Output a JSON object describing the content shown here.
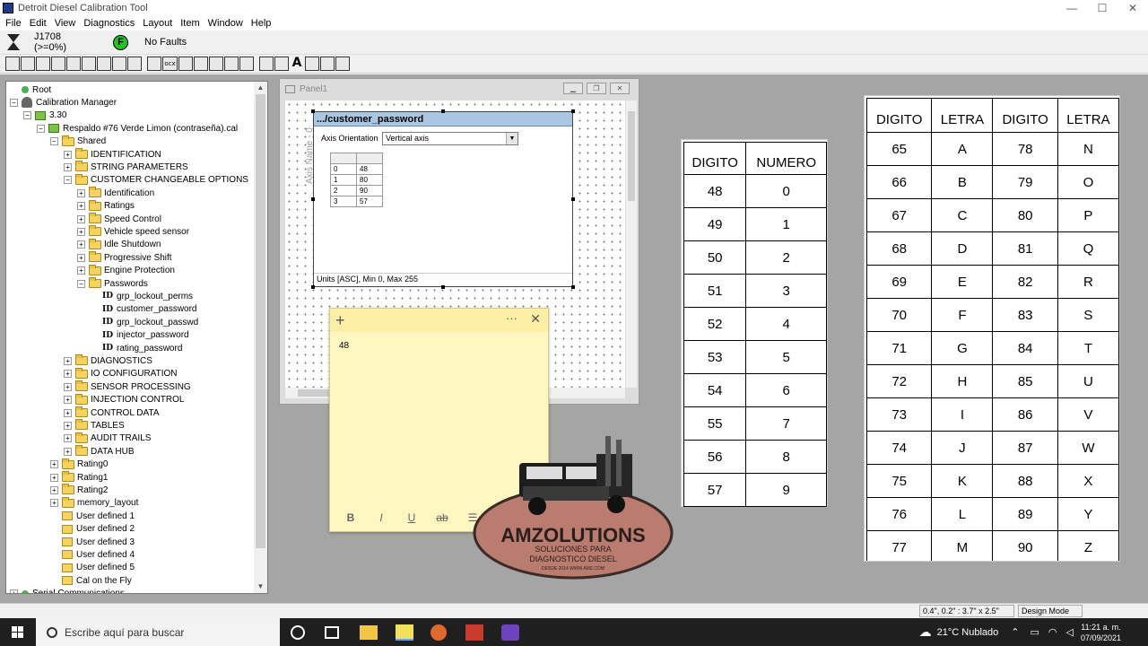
{
  "window": {
    "title": "Detroit Diesel Calibration Tool",
    "min": "—",
    "max": "☐",
    "close": "✕"
  },
  "menu": [
    "File",
    "Edit",
    "View",
    "Diagnostics",
    "Layout",
    "Item",
    "Window",
    "Help"
  ],
  "status": {
    "j1708": "J1708 (>=0%)",
    "fault_letter": "F",
    "faults": "No Faults"
  },
  "toolbar_icons": [
    "chart",
    "grid",
    "tools",
    "rect",
    "table",
    "truck",
    "curve",
    "thermo",
    "bar",
    "sep",
    "panel",
    "ocx",
    "matrix",
    "plusminus1",
    "plusminus2",
    "plusminus3",
    "plusminus4",
    "sep",
    "box",
    "dots",
    "text",
    "picture",
    "slider",
    "label"
  ],
  "tree": [
    {
      "label": "Root",
      "indent": 0,
      "icon": "dot",
      "exp": ""
    },
    {
      "label": "Calibration Manager",
      "indent": 0,
      "icon": "person",
      "exp": "−"
    },
    {
      "label": "3.30",
      "indent": 1,
      "icon": "cal",
      "exp": "−"
    },
    {
      "label": "Respaldo #76 Verde Limon (contraseña).cal",
      "indent": 2,
      "icon": "cal",
      "exp": "−"
    },
    {
      "label": "Shared",
      "indent": 3,
      "icon": "folder",
      "exp": "−"
    },
    {
      "label": "IDENTIFICATION",
      "indent": 4,
      "icon": "folder",
      "exp": "+"
    },
    {
      "label": "STRING PARAMETERS",
      "indent": 4,
      "icon": "folder",
      "exp": "+"
    },
    {
      "label": "CUSTOMER CHANGEABLE OPTIONS",
      "indent": 4,
      "icon": "folder",
      "exp": "−"
    },
    {
      "label": "Identification",
      "indent": 5,
      "icon": "folder",
      "exp": "+"
    },
    {
      "label": "Ratings",
      "indent": 5,
      "icon": "folder",
      "exp": "+"
    },
    {
      "label": "Speed Control",
      "indent": 5,
      "icon": "folder",
      "exp": "+"
    },
    {
      "label": "Vehicle speed sensor",
      "indent": 5,
      "icon": "folder",
      "exp": "+"
    },
    {
      "label": "Idle Shutdown",
      "indent": 5,
      "icon": "folder",
      "exp": "+"
    },
    {
      "label": "Progressive Shift",
      "indent": 5,
      "icon": "folder",
      "exp": "+"
    },
    {
      "label": "Engine Protection",
      "indent": 5,
      "icon": "folder",
      "exp": "+"
    },
    {
      "label": "Passwords",
      "indent": 5,
      "icon": "folder",
      "exp": "−"
    },
    {
      "label": "grp_lockout_perms",
      "indent": 6,
      "icon": "id",
      "exp": ""
    },
    {
      "label": "customer_password",
      "indent": 6,
      "icon": "id",
      "exp": ""
    },
    {
      "label": "grp_lockout_passwd",
      "indent": 6,
      "icon": "id",
      "exp": ""
    },
    {
      "label": "injector_password",
      "indent": 6,
      "icon": "id",
      "exp": ""
    },
    {
      "label": "rating_password",
      "indent": 6,
      "icon": "id",
      "exp": ""
    },
    {
      "label": "DIAGNOSTICS",
      "indent": 4,
      "icon": "folder",
      "exp": "+"
    },
    {
      "label": "IO CONFIGURATION",
      "indent": 4,
      "icon": "folder",
      "exp": "+"
    },
    {
      "label": "SENSOR PROCESSING",
      "indent": 4,
      "icon": "folder",
      "exp": "+"
    },
    {
      "label": "INJECTION CONTROL",
      "indent": 4,
      "icon": "folder",
      "exp": "+"
    },
    {
      "label": "CONTROL DATA",
      "indent": 4,
      "icon": "folder",
      "exp": "+"
    },
    {
      "label": "TABLES",
      "indent": 4,
      "icon": "folder",
      "exp": "+"
    },
    {
      "label": "AUDIT TRAILS",
      "indent": 4,
      "icon": "folder",
      "exp": "+"
    },
    {
      "label": "DATA HUB",
      "indent": 4,
      "icon": "folder",
      "exp": "+"
    },
    {
      "label": "Rating0",
      "indent": 3,
      "icon": "folder",
      "exp": "+"
    },
    {
      "label": "Rating1",
      "indent": 3,
      "icon": "folder",
      "exp": "+"
    },
    {
      "label": "Rating2",
      "indent": 3,
      "icon": "folder",
      "exp": "+"
    },
    {
      "label": "memory_layout",
      "indent": 3,
      "icon": "folder",
      "exp": "+"
    },
    {
      "label": "User defined 1",
      "indent": 3,
      "icon": "user",
      "exp": ""
    },
    {
      "label": "User defined 2",
      "indent": 3,
      "icon": "user",
      "exp": ""
    },
    {
      "label": "User defined 3",
      "indent": 3,
      "icon": "user",
      "exp": ""
    },
    {
      "label": "User defined 4",
      "indent": 3,
      "icon": "user",
      "exp": ""
    },
    {
      "label": "User defined 5",
      "indent": 3,
      "icon": "user",
      "exp": ""
    },
    {
      "label": "Cal on the Fly",
      "indent": 3,
      "icon": "user",
      "exp": ""
    },
    {
      "label": "Serial Communications",
      "indent": 0,
      "icon": "dot",
      "exp": "+"
    }
  ],
  "panel1": {
    "title": "Panel1"
  },
  "widget": {
    "title": ".../customer_password",
    "orientation_label": "Axis Orientation",
    "orientation_value": "Vertical axis",
    "axis_name": "Axis Name - 0",
    "rows": [
      [
        "0",
        "48"
      ],
      [
        "1",
        "80"
      ],
      [
        "2",
        "90"
      ],
      [
        "3",
        "57"
      ]
    ],
    "units": "Units [ASC], Min 0, Max 255"
  },
  "sticky": {
    "plus": "+",
    "more": "···",
    "close": "✕",
    "text": "48",
    "bold": "B",
    "italic": "I",
    "underline": "U",
    "strike": "ab",
    "list": "☰"
  },
  "logo": {
    "name": "AMZOLUTIONS",
    "line1": "SOLUCIONES PARA",
    "line2": "DIAGNOSTICO DIESEL",
    "line3": "DESDE 2014 WWW.AMZ.COM"
  },
  "num_table": {
    "headers": [
      "DIGITO",
      "NUMERO"
    ],
    "rows": [
      [
        "48",
        "0"
      ],
      [
        "49",
        "1"
      ],
      [
        "50",
        "2"
      ],
      [
        "51",
        "3"
      ],
      [
        "52",
        "4"
      ],
      [
        "53",
        "5"
      ],
      [
        "54",
        "6"
      ],
      [
        "55",
        "7"
      ],
      [
        "56",
        "8"
      ],
      [
        "57",
        "9"
      ]
    ]
  },
  "let_table": {
    "headers": [
      "DIGITO",
      "LETRA",
      "DIGITO",
      "LETRA"
    ],
    "rows": [
      [
        "65",
        "A",
        "78",
        "N"
      ],
      [
        "66",
        "B",
        "79",
        "O"
      ],
      [
        "67",
        "C",
        "80",
        "P"
      ],
      [
        "68",
        "D",
        "81",
        "Q"
      ],
      [
        "69",
        "E",
        "82",
        "R"
      ],
      [
        "70",
        "F",
        "83",
        "S"
      ],
      [
        "71",
        "G",
        "84",
        "T"
      ],
      [
        "72",
        "H",
        "85",
        "U"
      ],
      [
        "73",
        "I",
        "86",
        "V"
      ],
      [
        "74",
        "J",
        "87",
        "W"
      ],
      [
        "75",
        "K",
        "88",
        "X"
      ],
      [
        "76",
        "L",
        "89",
        "Y"
      ],
      [
        "77",
        "M",
        "90",
        "Z"
      ]
    ]
  },
  "design_bar": {
    "coords": "0.4\", 0.2\" : 3.7\" x 2.5\"",
    "mode": "Design Mode"
  },
  "taskbar": {
    "search_placeholder": "Escribe aquí para buscar",
    "weather": "21°C  Nublado",
    "time": "11:21 a. m.",
    "date": "07/09/2021"
  }
}
